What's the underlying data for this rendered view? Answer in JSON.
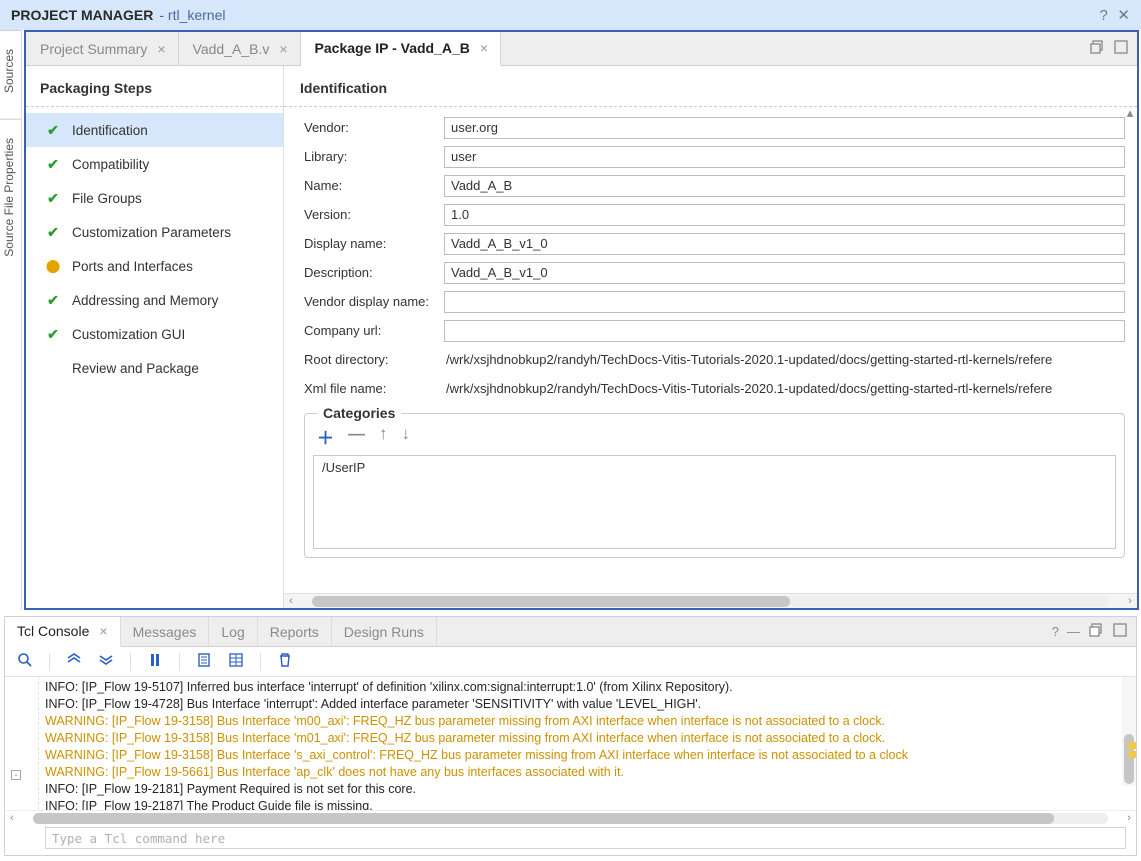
{
  "title_bar": {
    "title": "PROJECT MANAGER",
    "subtitle": "- rtl_kernel"
  },
  "side_tabs": [
    "Sources",
    "Source File Properties"
  ],
  "top_tabs": [
    {
      "label": "Project Summary",
      "active": false
    },
    {
      "label": "Vadd_A_B.v",
      "active": false
    },
    {
      "label": "Package IP - Vadd_A_B",
      "active": true
    }
  ],
  "steps_panel": {
    "title": "Packaging Steps",
    "items": [
      {
        "label": "Identification",
        "status": "check",
        "active": true
      },
      {
        "label": "Compatibility",
        "status": "check"
      },
      {
        "label": "File Groups",
        "status": "check"
      },
      {
        "label": "Customization Parameters",
        "status": "check"
      },
      {
        "label": "Ports and Interfaces",
        "status": "warn"
      },
      {
        "label": "Addressing and Memory",
        "status": "check"
      },
      {
        "label": "Customization GUI",
        "status": "check"
      },
      {
        "label": "Review and Package",
        "status": "none"
      }
    ]
  },
  "content": {
    "title": "Identification",
    "fields": {
      "vendor": {
        "label": "Vendor:",
        "value": "user.org"
      },
      "library": {
        "label": "Library:",
        "value": "user"
      },
      "name": {
        "label": "Name:",
        "value": "Vadd_A_B"
      },
      "version": {
        "label": "Version:",
        "value": "1.0"
      },
      "display_name": {
        "label": "Display name:",
        "value": "Vadd_A_B_v1_0"
      },
      "description": {
        "label": "Description:",
        "value": "Vadd_A_B_v1_0"
      },
      "vendor_display": {
        "label": "Vendor display name:",
        "value": ""
      },
      "company_url": {
        "label": "Company url:",
        "value": ""
      },
      "root_dir": {
        "label": "Root directory:",
        "value": "/wrk/xsjhdnobkup2/randyh/TechDocs-Vitis-Tutorials-2020.1-updated/docs/getting-started-rtl-kernels/refere"
      },
      "xml_file": {
        "label": "Xml file name:",
        "value": "/wrk/xsjhdnobkup2/randyh/TechDocs-Vitis-Tutorials-2020.1-updated/docs/getting-started-rtl-kernels/refere"
      }
    },
    "categories": {
      "title": "Categories",
      "items": [
        "/UserIP"
      ]
    }
  },
  "bottom_tabs": [
    {
      "label": "Tcl Console",
      "active": true
    },
    {
      "label": "Messages"
    },
    {
      "label": "Log"
    },
    {
      "label": "Reports"
    },
    {
      "label": "Design Runs"
    }
  ],
  "console": {
    "lines": [
      {
        "cls": "info",
        "text": "INFO: [IP_Flow 19-5107] Inferred bus interface 'interrupt' of definition 'xilinx.com:signal:interrupt:1.0' (from Xilinx Repository)."
      },
      {
        "cls": "info",
        "text": "INFO: [IP_Flow 19-4728] Bus Interface 'interrupt': Added interface parameter 'SENSITIVITY' with value 'LEVEL_HIGH'."
      },
      {
        "cls": "warning",
        "text": "WARNING: [IP_Flow 19-3158] Bus Interface 'm00_axi': FREQ_HZ bus parameter missing from AXI interface when interface is not associated to a clock."
      },
      {
        "cls": "warning",
        "text": "WARNING: [IP_Flow 19-3158] Bus Interface 'm01_axi': FREQ_HZ bus parameter missing from AXI interface when interface is not associated to a clock."
      },
      {
        "cls": "warning",
        "text": "WARNING: [IP_Flow 19-3158] Bus Interface 's_axi_control': FREQ_HZ bus parameter missing from AXI interface when interface is not associated to a clock"
      },
      {
        "cls": "warning",
        "text": "WARNING: [IP_Flow 19-5661] Bus Interface 'ap_clk' does not have any bus interfaces associated with it."
      },
      {
        "cls": "info",
        "text": "INFO: [IP_Flow 19-2181] Payment Required is not set for this core."
      },
      {
        "cls": "info",
        "text": "INFO: [IP_Flow 19-2187] The Product Guide file is missing."
      }
    ],
    "placeholder": "Type a Tcl command here"
  }
}
